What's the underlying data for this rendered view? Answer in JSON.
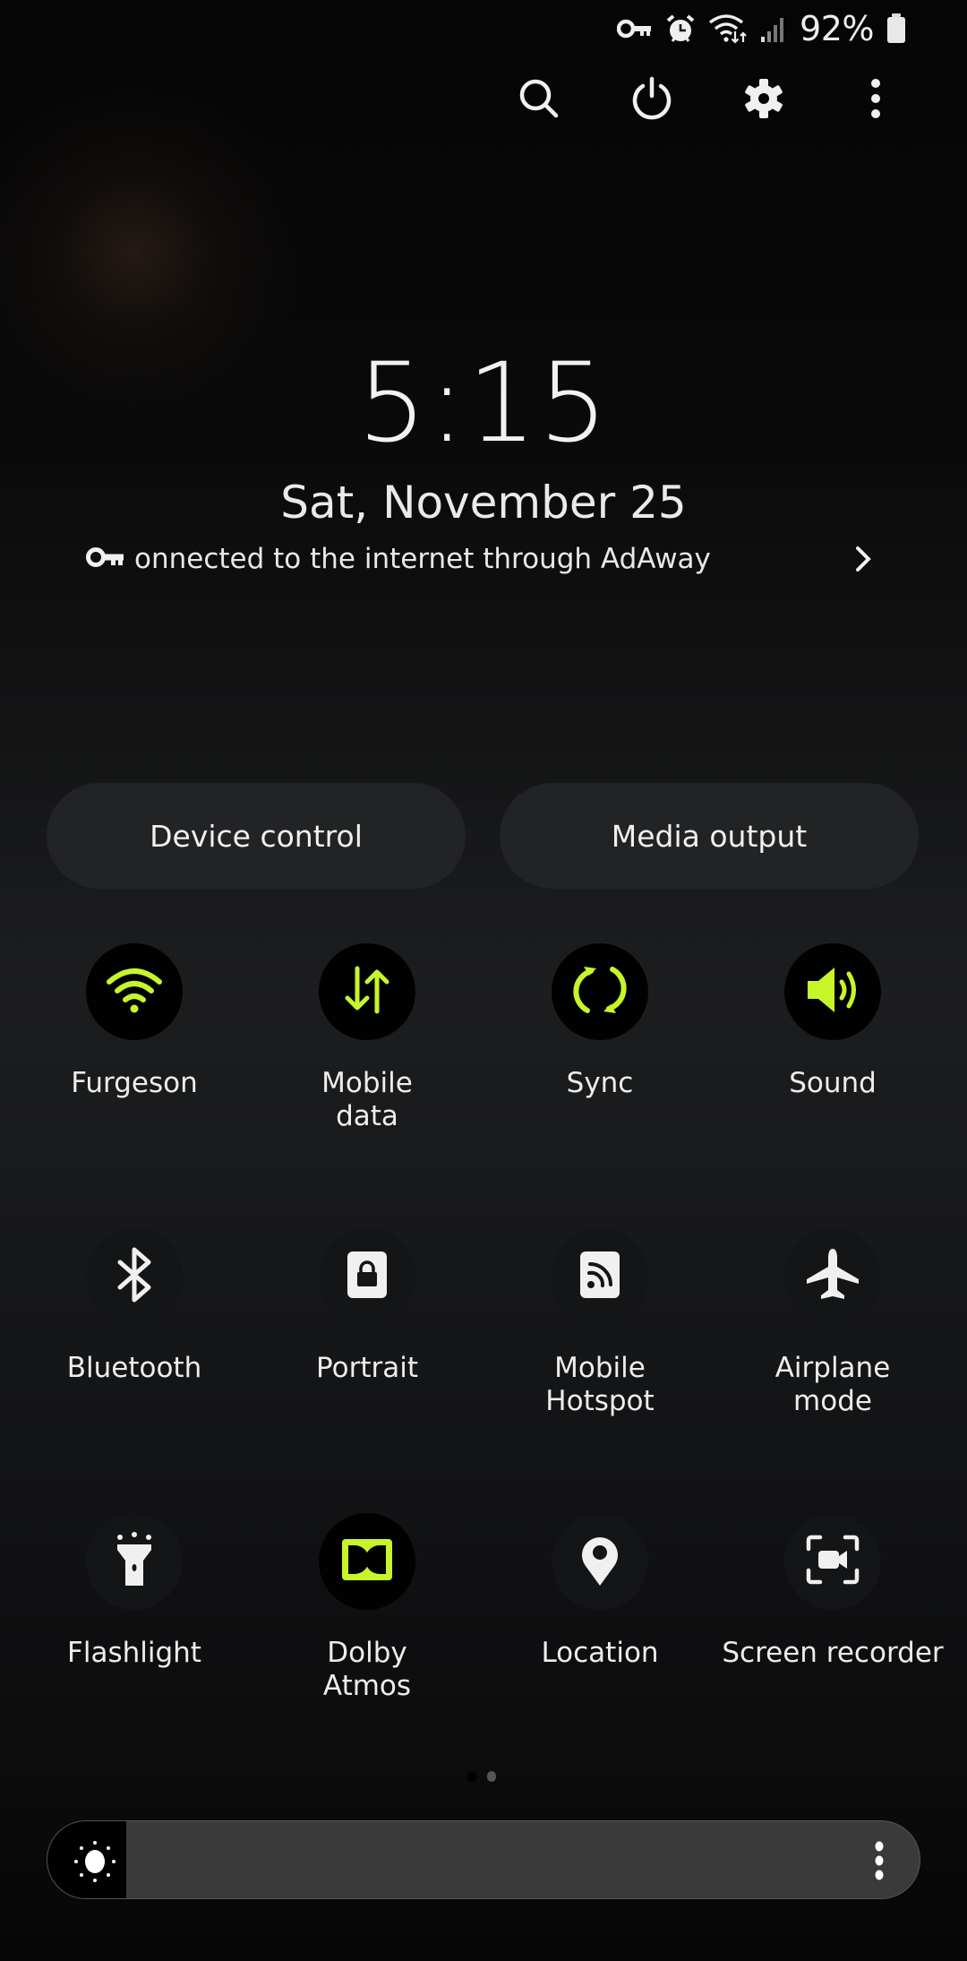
{
  "status_bar": {
    "icons": [
      "vpn-key-icon",
      "alarm-icon",
      "wifi-data-icon",
      "signal-icon",
      "battery-icon"
    ],
    "battery_percent": "92%"
  },
  "top_actions": {
    "search": "search-icon",
    "power": "power-icon",
    "settings": "gear-icon",
    "more": "more-vertical-icon"
  },
  "clock": {
    "time": "5:15",
    "date": "Sat, November 25"
  },
  "vpn_notice": {
    "text": "onnected to the internet through AdAway",
    "icon": "vpn-key-icon"
  },
  "pills": {
    "device_control": "Device control",
    "media_output": "Media output"
  },
  "tiles": [
    {
      "label": "Furgeson",
      "icon": "wifi-icon",
      "active": true
    },
    {
      "label": "Mobile\ndata",
      "icon": "mobile-data-icon",
      "active": true
    },
    {
      "label": "Sync",
      "icon": "sync-icon",
      "active": true
    },
    {
      "label": "Sound",
      "icon": "sound-icon",
      "active": true
    },
    {
      "label": "Bluetooth",
      "icon": "bluetooth-icon",
      "active": false
    },
    {
      "label": "Portrait",
      "icon": "portrait-lock-icon",
      "active": false
    },
    {
      "label": "Mobile\nHotspot",
      "icon": "hotspot-icon",
      "active": false
    },
    {
      "label": "Airplane\nmode",
      "icon": "airplane-icon",
      "active": false
    },
    {
      "label": "Flashlight",
      "icon": "flashlight-icon",
      "active": false
    },
    {
      "label": "Dolby\nAtmos",
      "icon": "dolby-icon",
      "active": true
    },
    {
      "label": "Location",
      "icon": "location-icon",
      "active": false
    },
    {
      "label": "Screen recorder",
      "icon": "screen-recorder-icon",
      "active": false
    }
  ],
  "pager": {
    "pages": 2,
    "current": 1
  },
  "brightness": {
    "level_percent": 9
  },
  "colors": {
    "accent": "#c6f52a",
    "tile_active_bg": "#010101",
    "tile_inactive_bg": "#141517",
    "icon_inactive": "#f0f0f0"
  }
}
